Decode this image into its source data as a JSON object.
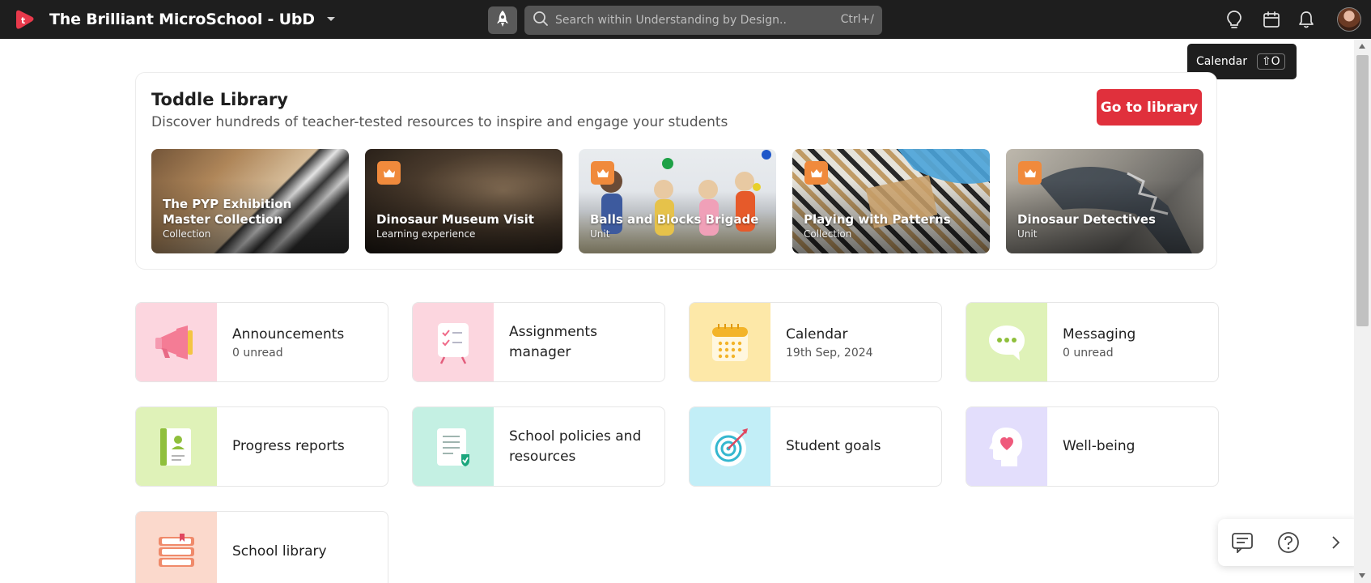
{
  "app": {
    "org_name": "The Brilliant MicroSchool - UbD",
    "search": {
      "placeholder": "Search within Understanding by Design..",
      "shortcut": "Ctrl+/"
    }
  },
  "tooltip": {
    "label": "Calendar",
    "shortcut": "⇧O"
  },
  "library": {
    "title": "Toddle Library",
    "subtitle": "Discover hundreds of teacher-tested resources to inspire and engage your students",
    "go_button": "Go to library",
    "tiles": [
      {
        "title": "The PYP Exhibition Master Collection",
        "type": "Collection",
        "badge": false
      },
      {
        "title": "Dinosaur Museum Visit",
        "type": "Learning experience",
        "badge": true
      },
      {
        "title": "Balls and Blocks Brigade",
        "type": "Unit",
        "badge": true
      },
      {
        "title": "Playing with Patterns",
        "type": "Collection",
        "badge": true
      },
      {
        "title": "Dinosaur Detectives",
        "type": "Unit",
        "badge": true
      }
    ]
  },
  "features": [
    {
      "title": "Announcements",
      "subtitle": "0 unread",
      "icon": "megaphone-icon",
      "color": "#fcd6df"
    },
    {
      "title": "Assignments manager",
      "subtitle": "",
      "icon": "checklist-icon",
      "color": "#fcd6df"
    },
    {
      "title": "Calendar",
      "subtitle": "19th Sep, 2024",
      "icon": "calendar-icon",
      "color": "#fde8a8"
    },
    {
      "title": "Messaging",
      "subtitle": "0 unread",
      "icon": "chat-icon",
      "color": "#dff2b8"
    },
    {
      "title": "Progress reports",
      "subtitle": "",
      "icon": "report-icon",
      "color": "#dff2b8"
    },
    {
      "title": "School policies and resources",
      "subtitle": "",
      "icon": "policy-doc-icon",
      "color": "#c4f0e3"
    },
    {
      "title": "Student goals",
      "subtitle": "",
      "icon": "target-icon",
      "color": "#c2eef7"
    },
    {
      "title": "Well-being",
      "subtitle": "",
      "icon": "heart-head-icon",
      "color": "#e3defc"
    },
    {
      "title": "School library",
      "subtitle": "",
      "icon": "books-icon",
      "color": "#fbd9cc"
    }
  ],
  "colors": {
    "topbar": "#1e1e1e",
    "accent_red": "#e0303c",
    "badge_orange": "#f08a3c"
  }
}
